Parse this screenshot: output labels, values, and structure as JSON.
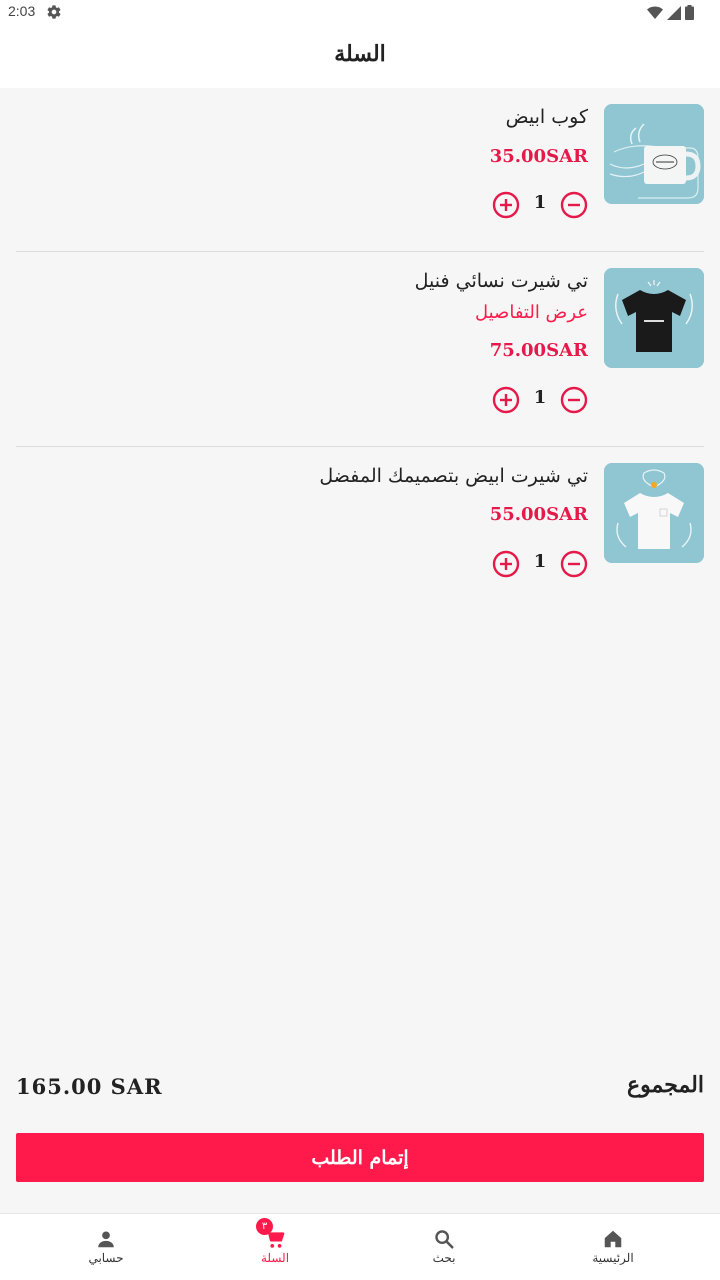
{
  "status_bar": {
    "time": "2:03"
  },
  "header": {
    "title": "السلة"
  },
  "cart": {
    "items": [
      {
        "name": "كوب ابيض",
        "details_label": "",
        "price": "35.00SAR",
        "quantity": "1"
      },
      {
        "name": "تي شيرت نسائي فنيل",
        "details_label": "عرض التفاصيل",
        "price": "75.00SAR",
        "quantity": "1"
      },
      {
        "name": "تي شيرت ابيض بتصميمك المفضل",
        "details_label": "",
        "price": "55.00SAR",
        "quantity": "1"
      }
    ]
  },
  "summary": {
    "total_label": "المجموع",
    "total_value": "165.00 SAR"
  },
  "checkout": {
    "label": "إتمام الطلب"
  },
  "bottom_nav": {
    "items": [
      {
        "label": "حسابي",
        "icon": "person-icon"
      },
      {
        "label": "السلة",
        "icon": "cart-icon",
        "badge": "٣"
      },
      {
        "label": "بحث",
        "icon": "search-icon"
      },
      {
        "label": "الرئيسية",
        "icon": "home-icon"
      }
    ],
    "active_color": "#ff1a4b"
  },
  "colors": {
    "accent": "#ff1a4b",
    "background": "#f6f6f6"
  }
}
